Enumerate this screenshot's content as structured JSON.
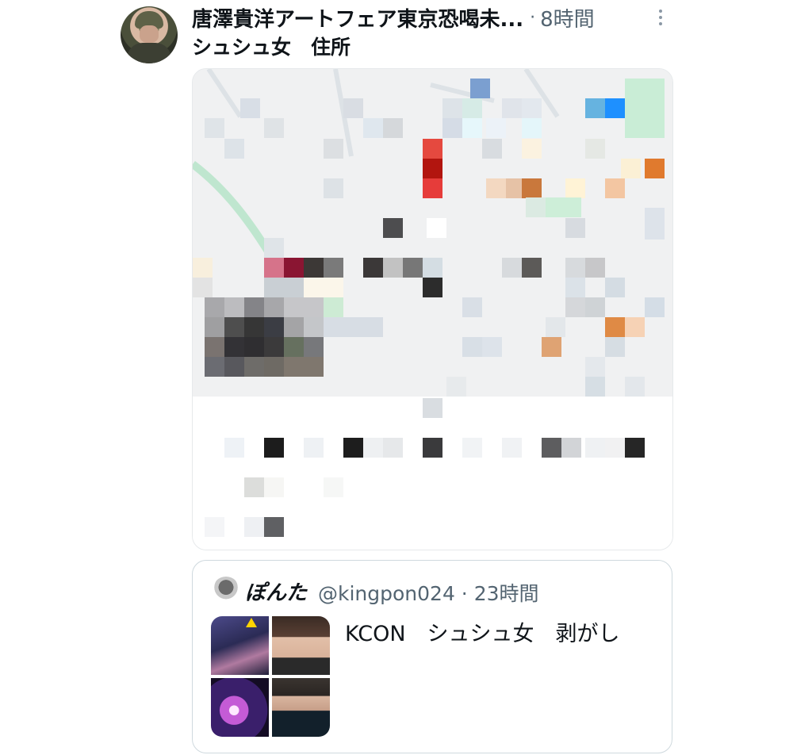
{
  "tweet": {
    "author_name": "唐澤貴洋アートフェア東京恐喝未...",
    "separator": "·",
    "time": "8時間",
    "text": "シュシュ女　住所",
    "more_icon": "more-vertical-icon"
  },
  "quoted_tweet": {
    "author_name": "ぽんた",
    "handle_and_time": "@kingpon024 · 23時間",
    "text": "KCON　シュシュ女　剥がし"
  },
  "colors": {
    "text_primary": "#0f1419",
    "text_secondary": "#536471",
    "border": "#cfd9de"
  }
}
